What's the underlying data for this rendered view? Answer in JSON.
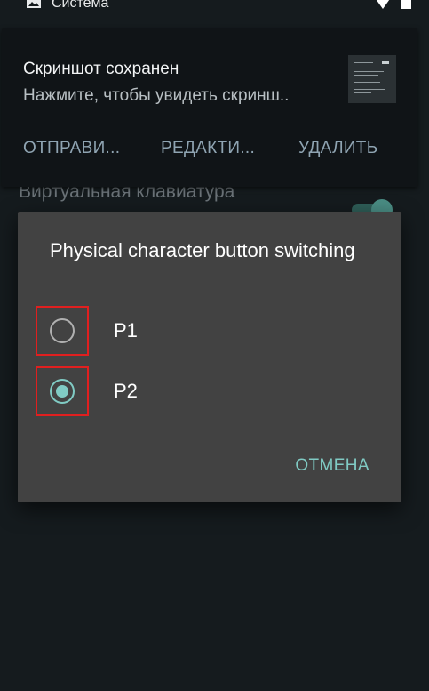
{
  "status_bar": {
    "app_name": "Система",
    "left_icon": "image-icon",
    "right_icons": [
      "wifi-icon",
      "battery-icon"
    ]
  },
  "notification": {
    "title": "Скриншот сохранен",
    "subtitle": "Нажмите, чтобы увидеть скринш..",
    "actions": [
      "ОТПРАВИ...",
      "РЕДАКТИ...",
      "УДАЛИТЬ"
    ]
  },
  "background": {
    "setting_title": "Виртуальная клавиатура",
    "toggle_on": true
  },
  "dialog": {
    "title": "Physical character button switching",
    "options": [
      {
        "label": "P1",
        "selected": false
      },
      {
        "label": "P2",
        "selected": true
      }
    ],
    "cancel_label": "ОТМЕНА"
  },
  "colors": {
    "background": "#151b1e",
    "dialog": "#424242",
    "accent": "#80cbc4",
    "highlight": "#e01f1f",
    "notification_action": "#8fa4b2"
  }
}
